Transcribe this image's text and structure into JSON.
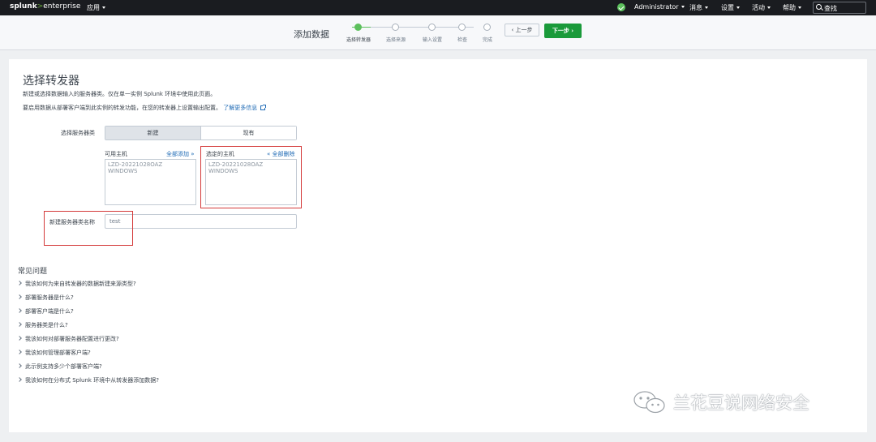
{
  "topbar": {
    "logo_main": "splunk",
    "logo_sep": ">",
    "logo_product": "enterprise",
    "apps_label": "应用",
    "user_label": "Administrator",
    "messages_label": "消息",
    "settings_label": "设置",
    "activity_label": "活动",
    "help_label": "帮助",
    "search_label": "查找"
  },
  "wizard": {
    "title": "添加数据",
    "steps": [
      {
        "label": "选择转发器",
        "state": "active"
      },
      {
        "label": "选择来源",
        "state": "pending"
      },
      {
        "label": "输入设置",
        "state": "pending"
      },
      {
        "label": "检查",
        "state": "pending"
      },
      {
        "label": "完成",
        "state": "pending"
      }
    ],
    "prev_label": "上一步",
    "next_label": "下一步"
  },
  "page": {
    "title": "选择转发器",
    "desc1": "新建或选择数据输入的服务器类。仅在单一实例 Splunk 环境中使用此页面。",
    "desc2": "要启用数据从部署客户端到此实例的转发功能，在您的转发器上设置输出配置。",
    "learn_more": "了解更多信息"
  },
  "form": {
    "server_class_label": "选择服务器类",
    "toggle_new": "新建",
    "toggle_existing": "现有",
    "available_hosts_label": "可用主机",
    "add_all_label": "全部添加 »",
    "available_hosts": [
      "LZD-20221028OAZ",
      "WINDOWS"
    ],
    "selected_hosts_label": "选定的主机",
    "remove_all_label": "« 全部删除",
    "selected_hosts": [
      "LZD-20221028OAZ",
      "WINDOWS"
    ],
    "new_class_name_label": "新建服务器类名称",
    "new_class_name_value": "test"
  },
  "faq": {
    "title": "常见问题",
    "items": [
      "我该如何为来自转发器的数据新建来源类型?",
      "部署服务器是什么?",
      "部署客户端是什么?",
      "服务器类是什么?",
      "我该如何对部署服务器配置进行更改?",
      "我该如何管理部署客户端?",
      "此示例支持多少个部署客户端?",
      "我该如何在分布式 Splunk 环境中从转发器添加数据?"
    ]
  },
  "watermark": {
    "text": "兰花豆说网络安全"
  },
  "colors": {
    "accent_green": "#5cc05c",
    "next_button": "#1a9a3a",
    "link_blue": "#1e6ab5",
    "highlight_red": "#d43a3a"
  }
}
